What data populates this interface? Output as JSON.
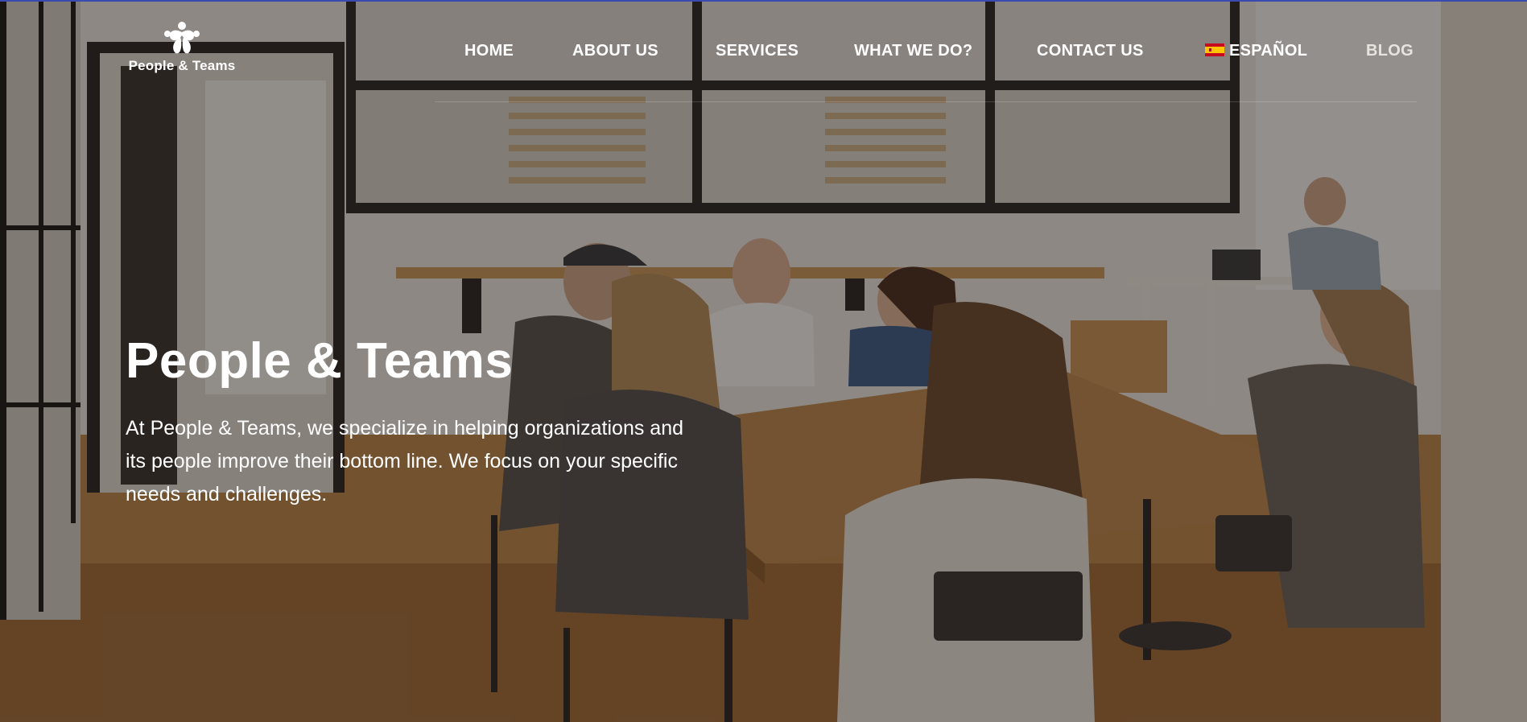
{
  "brand": {
    "name": "People & Teams",
    "logo_icon": "people-flower-icon"
  },
  "nav": {
    "items": [
      {
        "label": "HOME"
      },
      {
        "label": "ABOUT US"
      },
      {
        "label": "SERVICES"
      },
      {
        "label": "WHAT WE DO?"
      },
      {
        "label": "CONTACT US"
      },
      {
        "label": "ESPAÑOL",
        "icon": "spain-flag-icon"
      },
      {
        "label": "BLOG"
      }
    ]
  },
  "hero": {
    "title": "People & Teams",
    "description": "At People & Teams, we specialize in helping organizations and its people improve their bottom line. We focus on your specific needs and challenges."
  },
  "colors": {
    "text": "#ffffff",
    "overlay": "#120e0c",
    "top_line": "#3a4bb0",
    "flag_red": "#c60b1e",
    "flag_yellow": "#ffc400"
  }
}
